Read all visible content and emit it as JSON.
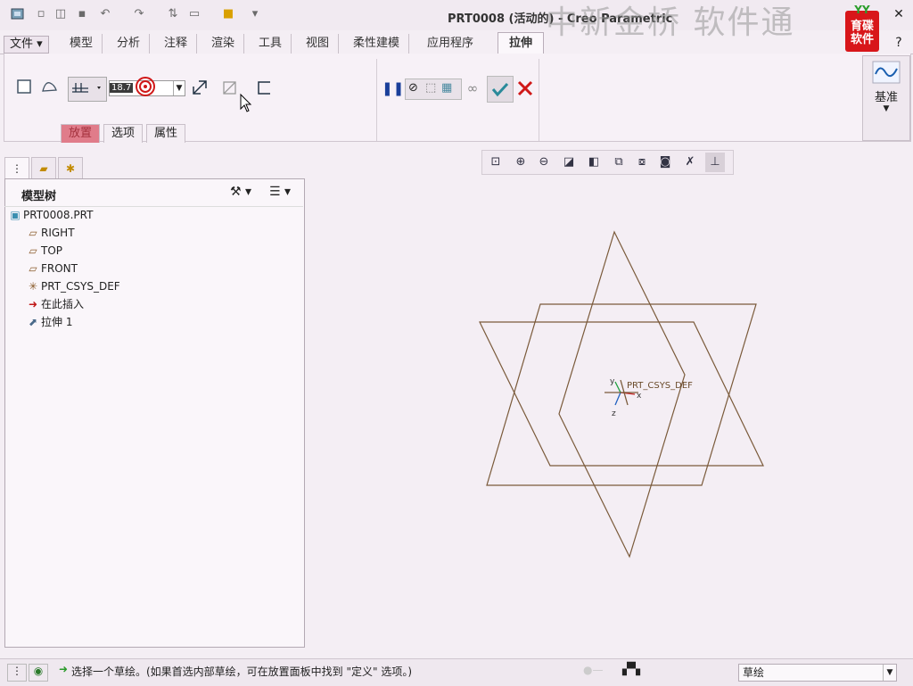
{
  "title": "PRT0008 (活动的) - Creo Parametric",
  "watermark": "中新金桥  软件通",
  "logo": {
    "top": "YY",
    "line1": "育碟",
    "line2": "软件"
  },
  "quick_access": {
    "icons": [
      "app-icon",
      "new-icon",
      "open-icon",
      "save-icon",
      "undo-icon",
      "redo-icon",
      "regenerate-icon",
      "window-icon",
      "folder-icon",
      "customize-icon"
    ]
  },
  "tabs": {
    "file": "文件",
    "model": "模型",
    "analysis": "分析",
    "annotate": "注释",
    "render": "渲染",
    "tools": "工具",
    "view": "视图",
    "flexible": "柔性建模",
    "apps": "应用程序",
    "extrude": "拉伸"
  },
  "ribbon": {
    "depth_value": "18.7",
    "subtabs": {
      "placement": "放置",
      "options": "选项",
      "properties": "属性"
    },
    "datum_label": "基准"
  },
  "model_tree": {
    "title": "模型树",
    "nodes": [
      {
        "label": "PRT0008.PRT",
        "icon": "part-icon"
      },
      {
        "label": "RIGHT",
        "icon": "datum-plane-icon"
      },
      {
        "label": "TOP",
        "icon": "datum-plane-icon"
      },
      {
        "label": "FRONT",
        "icon": "datum-plane-icon"
      },
      {
        "label": "PRT_CSYS_DEF",
        "icon": "csys-icon"
      },
      {
        "label": "在此插入",
        "icon": "insert-arrow-icon"
      },
      {
        "label": "拉伸 1",
        "icon": "extrude-feature-icon"
      }
    ]
  },
  "graphics": {
    "csys_label": "PRT_CSYS_DEF",
    "axis_labels": {
      "x": "x",
      "y": "y",
      "z": "z"
    },
    "plane_color": "#7a5a3a"
  },
  "status": {
    "message": "选择一个草绘。(如果首选内部草绘，可在放置面板中找到 \"定义\" 选项。)",
    "filter_value": "草绘"
  },
  "colors": {
    "accent_subtab": "#e07c8a",
    "confirm": "#2a8a9a",
    "cancel": "#d01818",
    "pause": "#1a3f9a"
  }
}
